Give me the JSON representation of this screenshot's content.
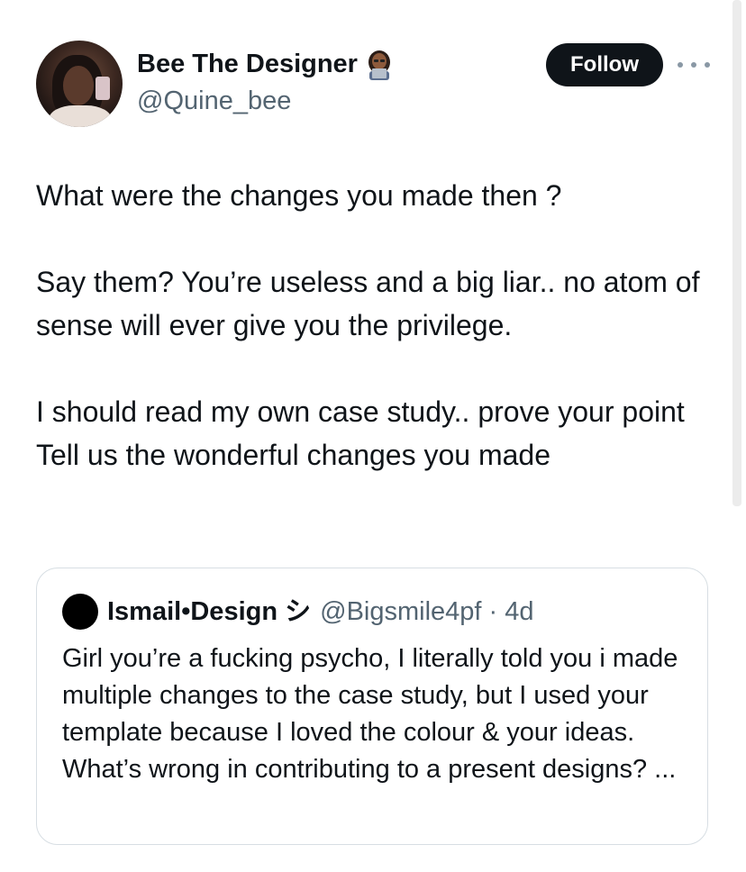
{
  "author": {
    "display_name": "Bee The Designer",
    "handle": "@Quine_bee",
    "badge_icon": "woman-technologist-emoji"
  },
  "follow_label": "Follow",
  "more_icon": "more-horizontal-icon",
  "tweet": {
    "lines": [
      "What were the changes you made then ?",
      "",
      "Say them? You’re useless and a big liar.. no atom of sense will ever give you the privilege.",
      "",
      "I should read my own case study.. prove your point",
      "Tell us the wonderful changes you made"
    ]
  },
  "quote": {
    "display_name": "Ismail•Design シ",
    "handle_time": "@Bigsmile4pf · 4d",
    "text": "Girl you’re a fucking psycho, I literally told you i made multiple changes to the case study, but I used your template because I loved the colour & your ideas. What’s wrong in contributing to a present designs? ..."
  },
  "colors": {
    "text": "#0f1419",
    "secondary": "#536471",
    "border": "#d7dee3",
    "button_bg": "#0f1419"
  }
}
